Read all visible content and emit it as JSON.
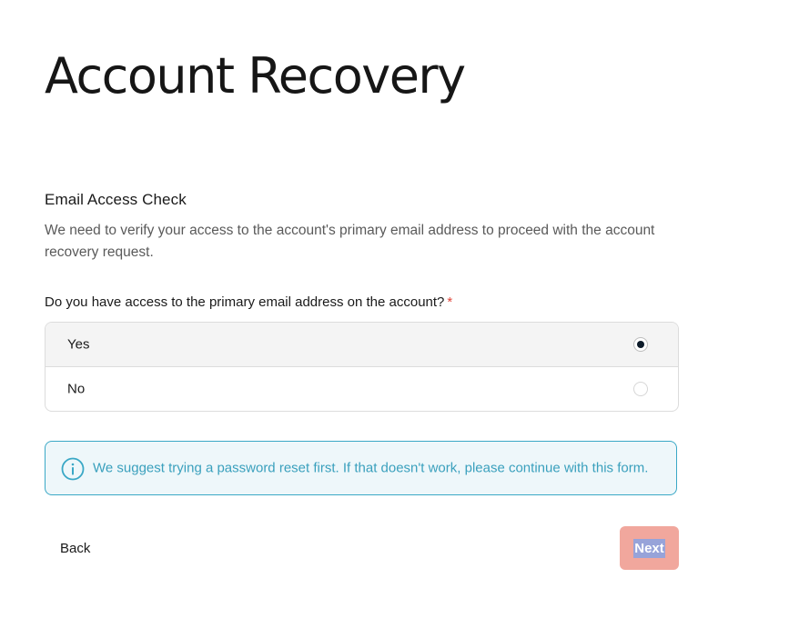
{
  "page": {
    "title": "Account Recovery"
  },
  "section": {
    "heading": "Email Access Check",
    "description": "We need to verify your access to the account's primary email address to proceed with the account recovery request."
  },
  "question": {
    "label": "Do you have access to the primary email address on the account?",
    "required_marker": "*",
    "options": [
      {
        "label": "Yes",
        "selected": true
      },
      {
        "label": "No",
        "selected": false
      }
    ]
  },
  "info": {
    "icon": "info-circle-icon",
    "text": "We suggest trying a password reset first. If that doesn't work, please continue with this form."
  },
  "actions": {
    "back_label": "Back",
    "next_label": "Next",
    "next_disabled": true
  },
  "colors": {
    "accent_required": "#e0453a",
    "info_border": "#3aa8c6",
    "info_background": "#eef7fa",
    "info_text": "#3aa0bd",
    "next_button_background": "#f1a79d",
    "radio_checked": "#0d1b2a"
  }
}
